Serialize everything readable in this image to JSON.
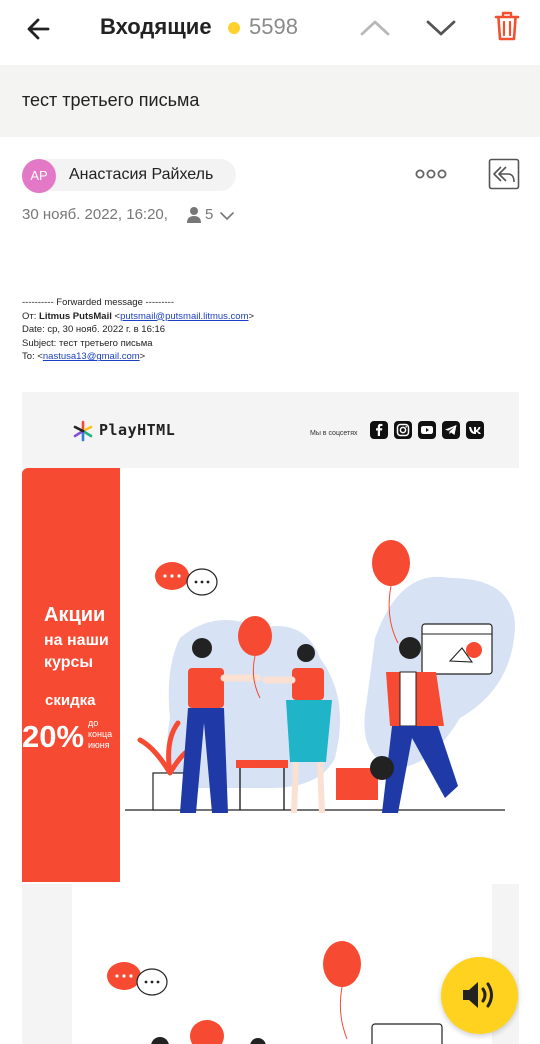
{
  "topbar": {
    "title": "Входящие",
    "unread_count": "5598",
    "dot_color": "#ffd12e",
    "icons": [
      "back-arrow-icon",
      "chevron-up-icon",
      "chevron-down-icon",
      "trash-icon"
    ]
  },
  "message": {
    "subject": "тест третьего письма",
    "sender": {
      "initials": "АР",
      "name": "Анастасия Райхель",
      "avatar_color": "#e379c6"
    },
    "date": "30 нояб. 2022, 16:20,",
    "recipients_count": "5",
    "forwarded": {
      "separator": "---------- Forwarded message ---------",
      "from_label": "От:",
      "from_name": "Litmus PutsMail",
      "from_email": "putsmail@putsmail.litmus.com",
      "date_line": "Date: ср, 30 нояб. 2022 г. в 16:16",
      "subject_line": "Subject: тест третьего письма",
      "to_label": "To:",
      "to_email": "nastusa13@gmail.com"
    }
  },
  "email_body": {
    "brand": "PlayHTML",
    "social_label": "Мы в соцсетях",
    "social_icons": [
      "facebook-icon",
      "instagram-icon",
      "youtube-icon",
      "telegram-icon",
      "vk-icon"
    ],
    "promo": {
      "line1": "Акции",
      "line2": "на наши",
      "line3": "курсы",
      "line4": "скидка",
      "percent": "20%",
      "until_1": "до",
      "until_2": "конца",
      "until_3": "июня",
      "accent_color": "#f64a33"
    }
  },
  "audio_button": {
    "icon": "speaker-icon",
    "color": "#ffd21f"
  }
}
